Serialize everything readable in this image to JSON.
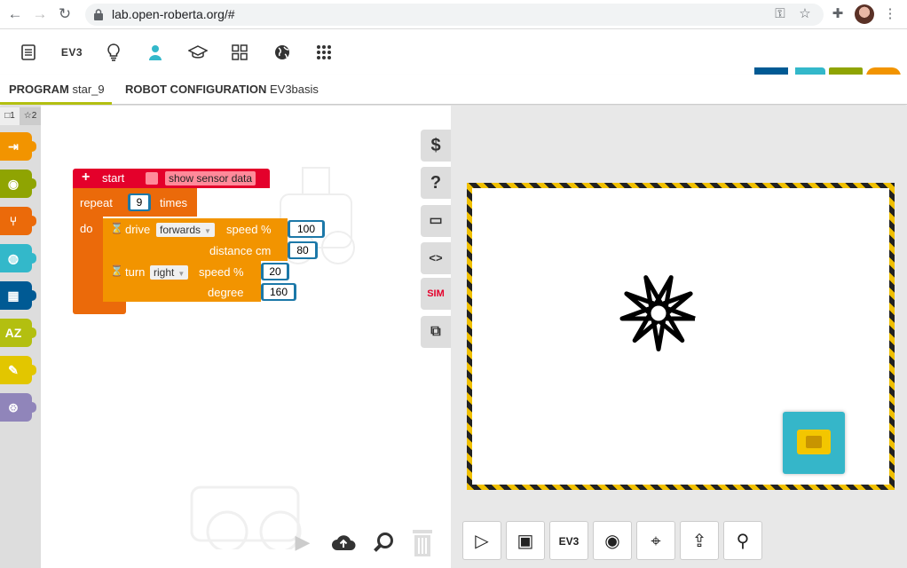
{
  "browser": {
    "url": "lab.open-roberta.org/#",
    "back": "←",
    "forward": "→",
    "reload": "↻"
  },
  "menubar": {
    "ev3_label": "EV3"
  },
  "tabs": {
    "program": {
      "label": "PROGRAM",
      "value": "star_9"
    },
    "robot_config": {
      "label": "ROBOT CONFIGURATION",
      "value": "EV3basis"
    }
  },
  "toolbox": {
    "levels": [
      {
        "label": "□1"
      },
      {
        "label": "☆2"
      }
    ],
    "categories": [
      {
        "name": "action",
        "color": "#f29400"
      },
      {
        "name": "sensors",
        "color": "#8fa402"
      },
      {
        "name": "control",
        "color": "#eb6a0a"
      },
      {
        "name": "logic",
        "color": "#33b8ca"
      },
      {
        "name": "math",
        "color": "#005a94"
      },
      {
        "name": "text",
        "color": "#b3bf10"
      },
      {
        "name": "colour",
        "color": "#e2c600"
      },
      {
        "name": "variables",
        "color": "#9085ba"
      }
    ]
  },
  "program": {
    "start": {
      "label": "start",
      "checkbox_label": "show sensor data"
    },
    "repeat": {
      "label": "repeat",
      "times_label": "times",
      "count": "9",
      "do_label": "do"
    },
    "drive": {
      "label": "drive",
      "direction": "forwards",
      "speed_label": "speed %",
      "speed": "100",
      "distance_label": "distance cm",
      "distance": "80"
    },
    "turn": {
      "label": "turn",
      "direction": "right",
      "speed_label": "speed %",
      "speed": "20",
      "degree_label": "degree",
      "degree": "160"
    }
  },
  "side_buttons": [
    {
      "name": "code-export",
      "glyph": "$"
    },
    {
      "name": "help",
      "glyph": "?"
    },
    {
      "name": "comment",
      "glyph": "▭"
    },
    {
      "name": "source-code",
      "glyph": "<>"
    },
    {
      "name": "sim",
      "glyph": "SIM"
    },
    {
      "name": "simulation-import",
      "glyph": "⧉"
    }
  ],
  "sim_controls": [
    {
      "name": "play",
      "glyph": "▷"
    },
    {
      "name": "background-image",
      "glyph": "▣"
    },
    {
      "name": "ev3",
      "glyph": "EV3"
    },
    {
      "name": "sensor",
      "glyph": "◉"
    },
    {
      "name": "location",
      "glyph": "⌖"
    },
    {
      "name": "export",
      "glyph": "⇪"
    },
    {
      "name": "link",
      "glyph": "⚲"
    }
  ],
  "colors": {
    "accent": "#b3bf10",
    "start_block": "#e4002b",
    "control_block": "#eb6a0a",
    "action_block": "#f29400",
    "number_block": "#1c78a8"
  }
}
